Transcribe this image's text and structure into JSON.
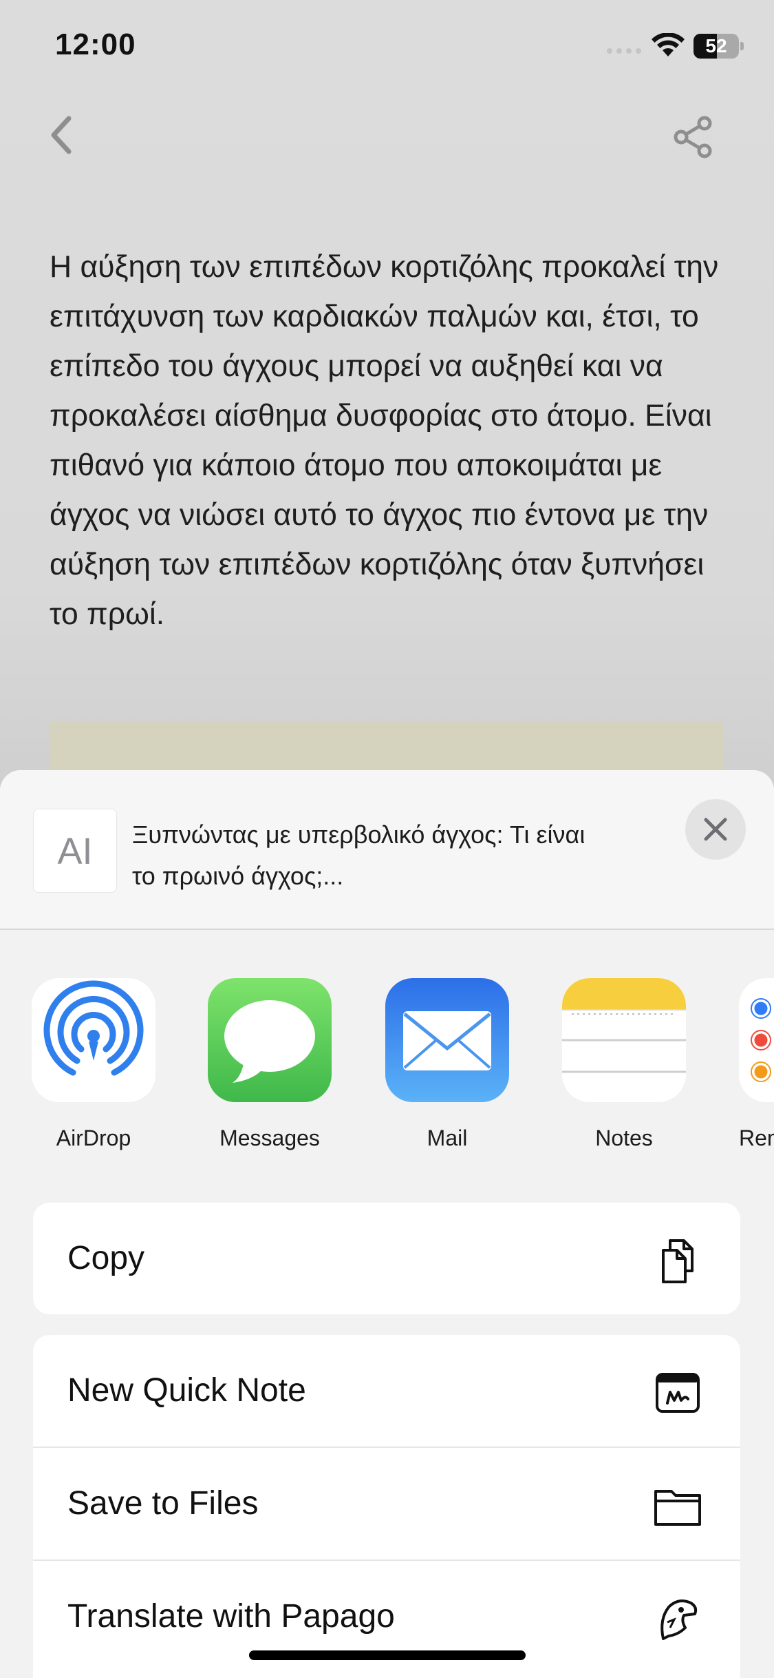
{
  "status_bar": {
    "time": "12:00",
    "battery_level": "52",
    "battery_fraction": 0.52
  },
  "article": {
    "body": "Η αύξηση των επιπέδων κορτιζόλης προκαλεί την επιτάχυνση των καρδιακών παλμών και, έτσι, το επίπεδο του άγχους μπορεί να αυξηθεί και να προκαλέσει αίσθημα δυσφορίας στο άτομο. Είναι πιθανό για κάποιο άτομο που αποκοιμάται με άγχος να νιώσει αυτό το άγχος πιο έντονα με την αύξηση των επιπέδων κορτιζόλης όταν ξυπνήσει το πρωί."
  },
  "share_sheet": {
    "title": "Ξυπνώντας με υπερβολικό άγχος: Τι είναι το πρωινό άγχος;...",
    "thumb_glyph": "AI",
    "apps": [
      {
        "label": "AirDrop",
        "icon": "airdrop-icon"
      },
      {
        "label": "Messages",
        "icon": "messages-icon"
      },
      {
        "label": "Mail",
        "icon": "mail-icon"
      },
      {
        "label": "Notes",
        "icon": "notes-icon"
      },
      {
        "label": "Rem",
        "icon": "reminders-icon"
      }
    ],
    "actions_primary": [
      {
        "label": "Copy",
        "icon": "copy-icon"
      }
    ],
    "actions_secondary": [
      {
        "label": "New Quick Note",
        "icon": "quick-note-icon"
      },
      {
        "label": "Save to Files",
        "icon": "folder-icon"
      },
      {
        "label": "Translate with Papago",
        "icon": "papago-icon"
      }
    ]
  },
  "colors": {
    "accent_blue": "#2f80ed",
    "messages_green": "#4cd964",
    "mail_blue": "#3d8ef7",
    "notes_yellow": "#f7cf3e"
  }
}
